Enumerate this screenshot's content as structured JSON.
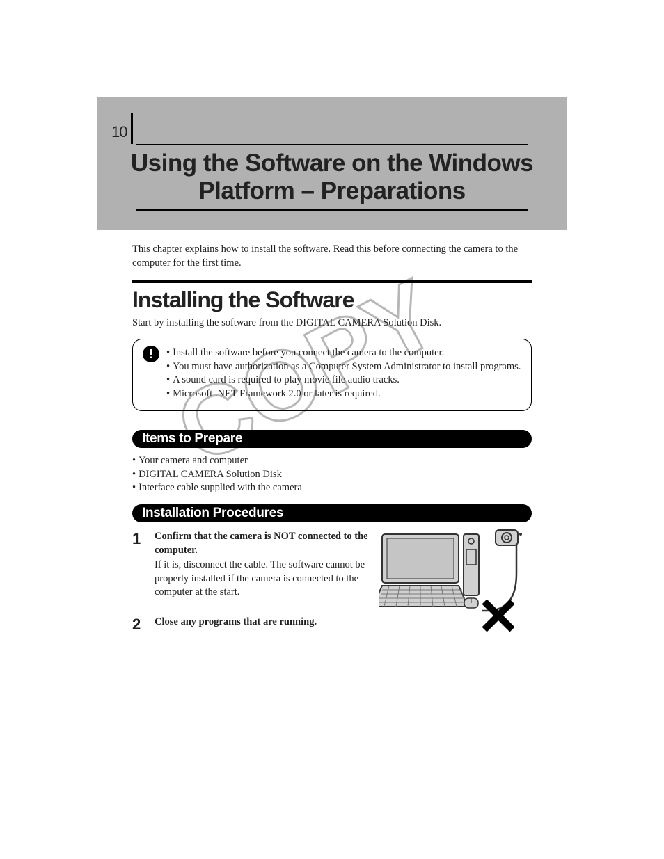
{
  "page_number": "10",
  "chapter_title_line1": "Using the Software on the Windows",
  "chapter_title_line2": "Platform – Preparations",
  "intro": "This chapter explains how to install the software. Read this before connecting the camera to the computer for the first time.",
  "section_heading": "Installing the Software",
  "section_sub": "Start by installing the software from the DIGITAL CAMERA Solution Disk.",
  "notes": [
    "Install the software before you connect the camera to the computer.",
    "You must have authorization as a Computer System Administrator to install programs.",
    "A sound card is required to play movie file audio tracks.",
    "Microsoft .NET Framework 2.0 or later is required."
  ],
  "bar_items": "Items to Prepare",
  "items": [
    "Your camera and computer",
    "DIGITAL CAMERA Solution Disk",
    "Interface cable supplied with the camera"
  ],
  "bar_proc": "Installation Procedures",
  "steps": [
    {
      "num": "1",
      "strong": "Confirm that the camera is NOT connected to the computer.",
      "detail": "If it is, disconnect the cable. The software cannot be properly installed if the camera is connected to the computer at the start."
    },
    {
      "num": "2",
      "strong": "Close any programs that are running.",
      "detail": ""
    }
  ],
  "watermark": "COPY"
}
